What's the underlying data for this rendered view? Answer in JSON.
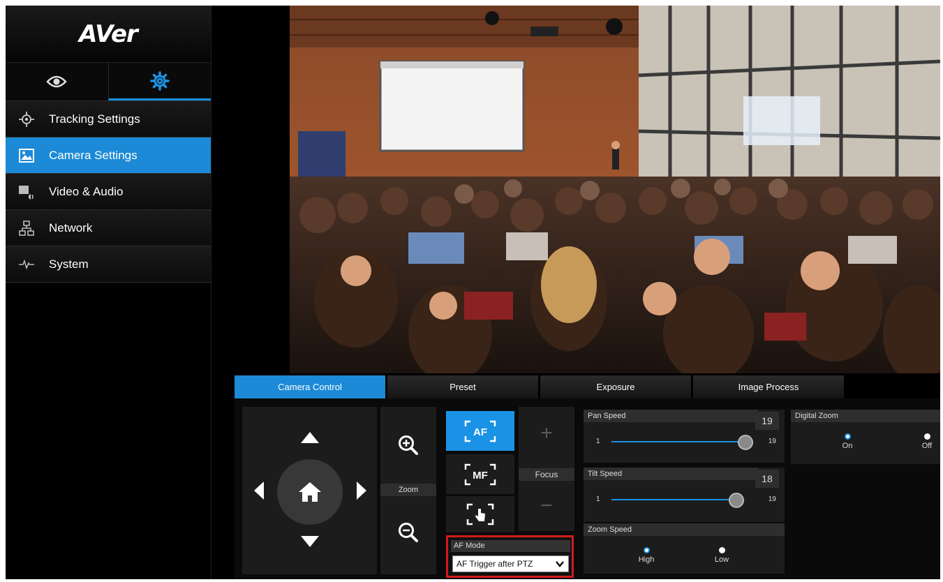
{
  "brand": {
    "logo_text": "AVer"
  },
  "mode_tabs": [
    {
      "icon": "eye-icon",
      "active": false
    },
    {
      "icon": "gear-icon",
      "active": true
    }
  ],
  "sidebar": {
    "items": [
      {
        "label": "Tracking Settings",
        "icon": "crosshair-icon",
        "active": false
      },
      {
        "label": "Camera Settings",
        "icon": "image-icon",
        "active": true
      },
      {
        "label": "Video & Audio",
        "icon": "video-audio-icon",
        "active": false
      },
      {
        "label": "Network",
        "icon": "network-icon",
        "active": false
      },
      {
        "label": "System",
        "icon": "pulse-icon",
        "active": false
      }
    ]
  },
  "control_tabs": [
    {
      "label": "Camera Control",
      "active": true
    },
    {
      "label": "Preset",
      "active": false
    },
    {
      "label": "Exposure",
      "active": false
    },
    {
      "label": "Image Process",
      "active": false
    }
  ],
  "zoom": {
    "label": "Zoom"
  },
  "focus": {
    "label": "Focus"
  },
  "af_buttons": {
    "af": "AF",
    "mf": "MF"
  },
  "af_mode": {
    "label": "AF Mode",
    "selected": "AF Trigger after PTZ"
  },
  "pan_speed": {
    "title": "Pan Speed",
    "value": "19",
    "min": "1",
    "max": "19"
  },
  "tilt_speed": {
    "title": "Tilt Speed",
    "value": "18",
    "min": "1",
    "max": "19"
  },
  "zoom_speed": {
    "title": "Zoom Speed",
    "options": [
      "High",
      "Low"
    ],
    "selected": "High"
  },
  "digital_zoom": {
    "title": "Digital Zoom",
    "options": [
      "On",
      "Off"
    ],
    "selected": "On"
  },
  "colors": {
    "accent": "#1c8ad6",
    "highlight": "#d21a1a"
  }
}
